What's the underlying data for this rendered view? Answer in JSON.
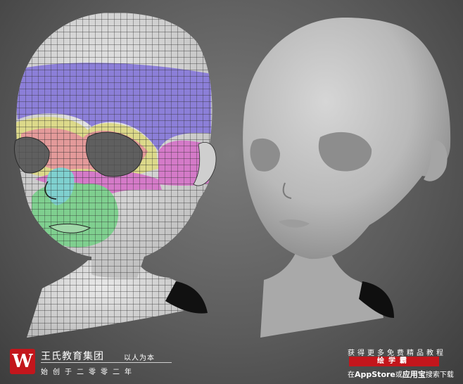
{
  "brand": {
    "logo_letter": "W",
    "name": "王氏教育集团",
    "motto": "以人为本",
    "slogan": "始创于二零零二年"
  },
  "promo": {
    "line1": "获得更多免费精品教程",
    "badge": "绘学霸",
    "line3_prefix": "在",
    "line3_store": "AppStore",
    "line3_or": "或",
    "line3_app": "应用宝",
    "line3_suffix": "搜索下载"
  },
  "colors": {
    "background": "#6a6a6a",
    "brand_red": "#c3161c",
    "region_purple": "#8c7fd8",
    "region_yellow": "#dcd98a",
    "region_pink": "#d47ac8",
    "region_salmon": "#e39a9a",
    "region_green": "#7fcf8f",
    "region_cyan": "#7fd0cf"
  }
}
